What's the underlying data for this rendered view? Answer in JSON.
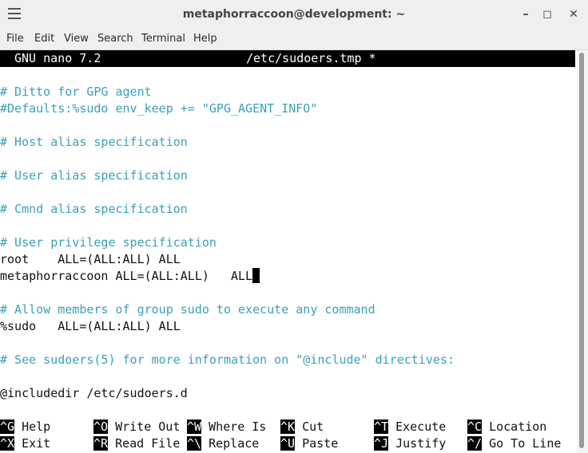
{
  "window": {
    "title": "metaphorraccoon@development: ~",
    "minimize": "–",
    "maximize": "◻",
    "close": "✕"
  },
  "menu": [
    "File",
    "Edit",
    "View",
    "Search",
    "Terminal",
    "Help"
  ],
  "nano": {
    "version": "GNU nano 7.2",
    "filename": "/etc/sudoers.tmp *"
  },
  "content": [
    "# Ditto for GPG agent",
    "#Defaults:%sudo env_keep += \"GPG_AGENT_INFO\"",
    "# Host alias specification",
    "# User alias specification",
    "# Cmnd alias specification",
    "# User privilege specification",
    "root    ALL=(ALL:ALL) ALL",
    "metaphorraccoon ALL=(ALL:ALL)   ALL",
    "# Allow members of group sudo to execute any command",
    "%sudo   ALL=(ALL:ALL) ALL",
    "# See sudoers(5) for more information on \"@include\" directives:",
    "@includedir /etc/sudoers.d"
  ],
  "shortcuts": [
    {
      "key": "^G",
      "label": "Help"
    },
    {
      "key": "^O",
      "label": "Write Out"
    },
    {
      "key": "^W",
      "label": "Where Is"
    },
    {
      "key": "^K",
      "label": "Cut"
    },
    {
      "key": "^T",
      "label": "Execute"
    },
    {
      "key": "^C",
      "label": "Location"
    },
    {
      "key": "^X",
      "label": "Exit"
    },
    {
      "key": "^R",
      "label": "Read File"
    },
    {
      "key": "^\\",
      "label": "Replace"
    },
    {
      "key": "^U",
      "label": "Paste"
    },
    {
      "key": "^J",
      "label": "Justify"
    },
    {
      "key": "^/",
      "label": "Go To Line"
    }
  ]
}
